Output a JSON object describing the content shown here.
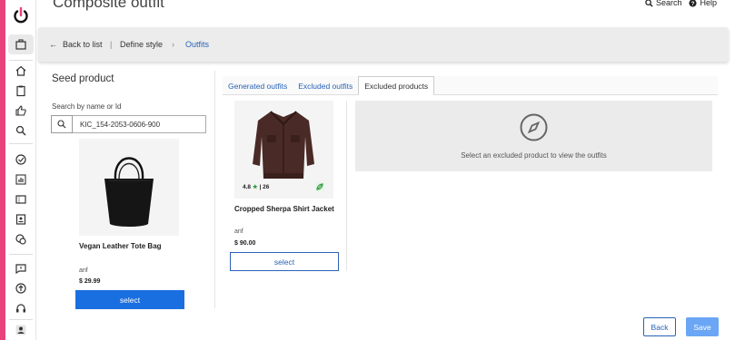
{
  "app": {
    "title": "Composite outfit",
    "search_label": "Search",
    "help_label": "Help"
  },
  "breadcrumb": {
    "back_label": "Back to list",
    "items": [
      "Define style",
      "Outfits"
    ]
  },
  "nav": {
    "icons": [
      "power-icon",
      "briefcase-icon",
      "home-icon",
      "clipboard-icon",
      "thumbs-up-icon",
      "search-icon",
      "check-circle-icon",
      "chart-icon",
      "ticket-icon",
      "id-card-icon",
      "tag-icon",
      "chat-icon",
      "upload-icon",
      "support-icon",
      "user-icon"
    ]
  },
  "seed": {
    "title": "Seed product",
    "search_label": "Search by name or Id",
    "search_value": "KIC_154-2053-0606-900",
    "product": {
      "name": "Vegan Leather Tote Bag",
      "brand": "anf",
      "price": "$ 29.99",
      "select_label": "select"
    }
  },
  "tabs": [
    {
      "label": "Generated outfits",
      "active": false
    },
    {
      "label": "Excluded outfits",
      "active": false
    },
    {
      "label": "Excluded products",
      "active": true
    }
  ],
  "excluded_product": {
    "rating": "4.8",
    "reviews": "26",
    "name": "Cropped Sherpa Shirt Jacket",
    "brand": "anf",
    "price": "$ 90.00",
    "select_label": "select"
  },
  "empty_state": {
    "text": "Select an excluded product to view the outfits"
  },
  "footer": {
    "back_label": "Back",
    "save_label": "Save"
  },
  "colors": {
    "accent": "#2a62b8",
    "primary_button": "#1a6fe0",
    "brand_pink": "#e8417c"
  }
}
